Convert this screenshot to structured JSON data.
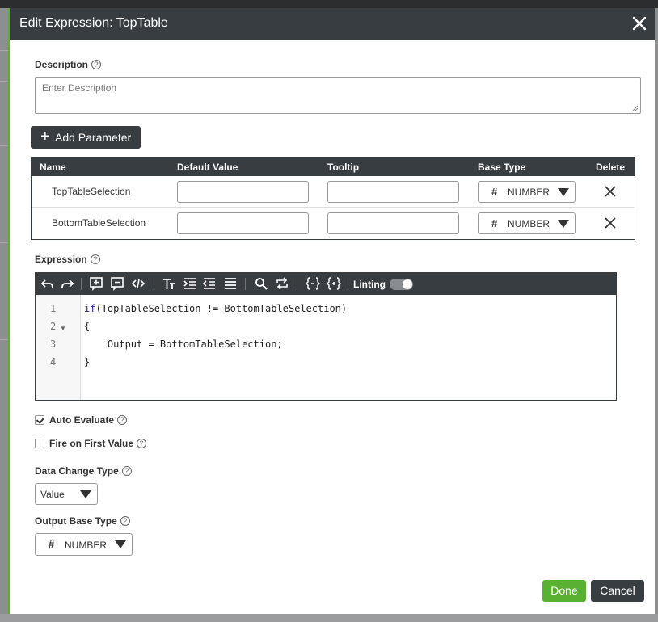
{
  "dialog": {
    "title": "Edit Expression: TopTable",
    "description_label": "Description",
    "description_placeholder": "Enter Description",
    "add_parameter_label": "Add Parameter"
  },
  "params_table": {
    "headers": [
      "Name",
      "Default Value",
      "Tooltip",
      "Base Type",
      "Delete"
    ],
    "rows": [
      {
        "name": "TopTableSelection",
        "default_value": "",
        "tooltip": "",
        "base_type": "NUMBER"
      },
      {
        "name": "BottomTableSelection",
        "default_value": "",
        "tooltip": "",
        "base_type": "NUMBER"
      }
    ]
  },
  "expression": {
    "label": "Expression",
    "linting_label": "Linting",
    "linting_on": true,
    "line_numbers": [
      "1",
      "2",
      "3",
      "4"
    ],
    "code": {
      "line1_kw": "if",
      "line1_rest": "(TopTableSelection != BottomTableSelection)",
      "line2": "{",
      "line3": "    Output = BottomTableSelection;",
      "line4": "}"
    }
  },
  "options": {
    "auto_evaluate_label": "Auto Evaluate",
    "auto_evaluate_checked": true,
    "fire_first_label": "Fire on First Value",
    "fire_first_checked": false,
    "data_change_label": "Data Change Type",
    "data_change_value": "Value",
    "output_base_label": "Output Base Type",
    "output_base_value": "NUMBER"
  },
  "footer": {
    "done_label": "Done",
    "cancel_label": "Cancel"
  },
  "colors": {
    "header_bg": "#383d41",
    "accent_green": "#5ab031"
  }
}
